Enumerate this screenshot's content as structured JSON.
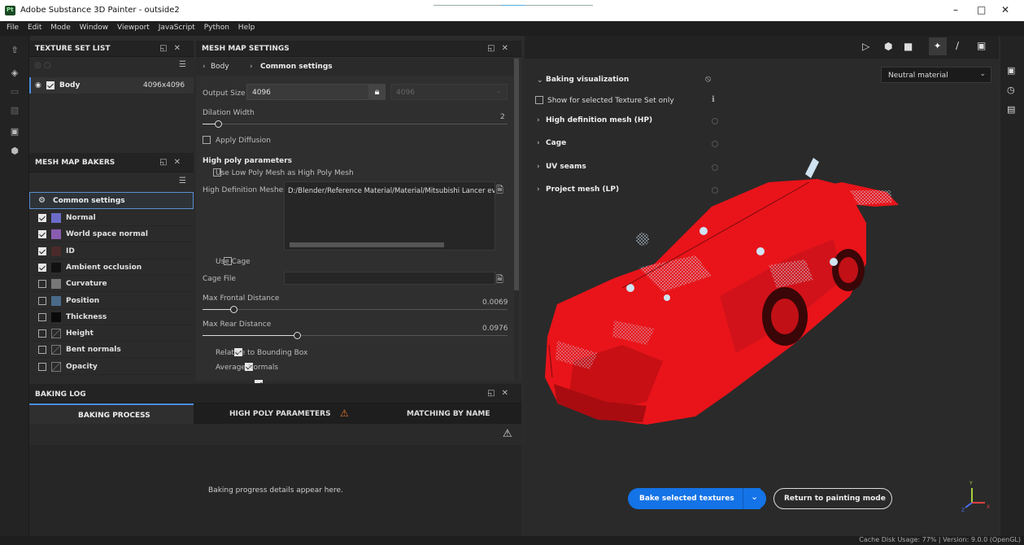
{
  "window": {
    "title": "Adobe Substance 3D Painter - outside2",
    "logo_text": "Pt",
    "min_glyph": "–",
    "max_glyph": "□",
    "close_glyph": "✕"
  },
  "menu": [
    "File",
    "Edit",
    "Mode",
    "Window",
    "Viewport",
    "JavaScript",
    "Python",
    "Help"
  ],
  "texture_set_list": {
    "title": "TEXTURE SET LIST",
    "set_name": "Body",
    "set_size": "4096x4096"
  },
  "mesh_map_bakers": {
    "title": "MESH MAP BAKERS",
    "common_settings": "Common settings",
    "items": [
      {
        "label": "Normal",
        "checked": true,
        "thumb": "#6c6cc8"
      },
      {
        "label": "World space normal",
        "checked": true,
        "thumb": "#8a5cb0"
      },
      {
        "label": "ID",
        "checked": true,
        "thumb": "#4a2a2a"
      },
      {
        "label": "Ambient occlusion",
        "checked": true,
        "thumb": "#111111"
      },
      {
        "label": "Curvature",
        "checked": false,
        "thumb": "#777777"
      },
      {
        "label": "Position",
        "checked": false,
        "thumb": "#4a6a8a"
      },
      {
        "label": "Thickness",
        "checked": false,
        "thumb": "#0a0a0a"
      },
      {
        "label": "Height",
        "checked": false,
        "thumb": "none"
      },
      {
        "label": "Bent normals",
        "checked": false,
        "thumb": "none"
      },
      {
        "label": "Opacity",
        "checked": false,
        "thumb": "none"
      }
    ]
  },
  "mesh_map_settings": {
    "title": "MESH MAP SETTINGS",
    "breadcrumb_1": "Body",
    "breadcrumb_2": "Common settings",
    "output_size_label": "Output Size",
    "output_size_value": "4096",
    "output_size_locked_value": "4096",
    "dilation_label": "Dilation Width",
    "dilation_value": "2",
    "dilation_fraction": 0.05,
    "apply_diffusion": "Apply Diffusion",
    "high_poly_header": "High poly parameters",
    "use_low_poly": "Use Low Poly Mesh as High Poly Mesh",
    "hd_meshes_label": "High Definition Meshes",
    "hd_meshes_value": "D:/Blender/Reference Material/Material/Mitsubishi Lancer evo x/F",
    "use_cage": "Use Cage",
    "cage_file_label": "Cage File",
    "max_frontal_label": "Max Frontal Distance",
    "max_frontal_value": "0.0069",
    "max_frontal_fraction": 0.1,
    "max_rear_label": "Max Rear Distance",
    "max_rear_value": "0.0976",
    "max_rear_fraction": 0.31,
    "relative_bbox": "Relative to Bounding Box",
    "average_normals": "Average Normals"
  },
  "baking_log": {
    "title": "BAKING LOG",
    "tab_baking_process": "BAKING PROCESS",
    "tab_high_poly": "HIGH POLY PARAMETERS",
    "tab_matching": "MATCHING BY NAME",
    "empty_message": "Baking progress details appear here."
  },
  "viewport": {
    "material_select": "Neutral material",
    "baking_visualization": "Baking visualization",
    "show_selected_only": "Show for selected Texture Set only",
    "hp_mesh": "High definition mesh (HP)",
    "cage": "Cage",
    "uv_seams": "UV seams",
    "project_mesh": "Project mesh (LP)",
    "bake_button": "Bake selected textures",
    "return_button": "Return to painting mode",
    "axis_y": "Y",
    "axis_x": "X",
    "axis_z": "Z"
  },
  "status": {
    "text": "Cache Disk Usage:  77% | Version: 9.0.0 (OpenGL)"
  },
  "colors": {
    "car_red": "#e8141a",
    "accent_blue": "#1473e6",
    "panel_bg": "#2b2b2b"
  }
}
